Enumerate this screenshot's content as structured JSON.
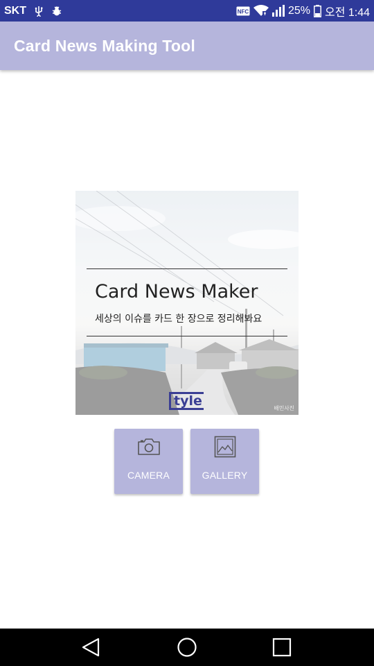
{
  "status_bar": {
    "carrier": "SKT",
    "icons_left": [
      "usb-icon",
      "debug-bug-icon"
    ],
    "icons_right": [
      "nfc-icon",
      "wifi-icon",
      "signal-icon",
      "battery-icon"
    ],
    "battery": "25%",
    "time": "오전 1:44"
  },
  "app_bar": {
    "title": "Card News Making Tool",
    "color": "#b5b5dc"
  },
  "card": {
    "title": "Card News Maker",
    "subtitle": "세상의 이슈를 카드 한 장으로 정리해봐요",
    "logo": "tyle",
    "watermark": "배민사진",
    "logo_color": "#3a3e94"
  },
  "buttons": {
    "camera_label": "CAMERA",
    "gallery_label": "GALLERY",
    "camera_icon": "camera-icon",
    "gallery_icon": "image-icon",
    "color": "#b5b5dc"
  },
  "nav_bar": {
    "back_icon": "back-triangle-icon",
    "home_icon": "home-circle-icon",
    "recent_icon": "recents-square-icon"
  },
  "colors": {
    "status_bar": "#2f3a9a",
    "accent": "#b5b5dc"
  }
}
